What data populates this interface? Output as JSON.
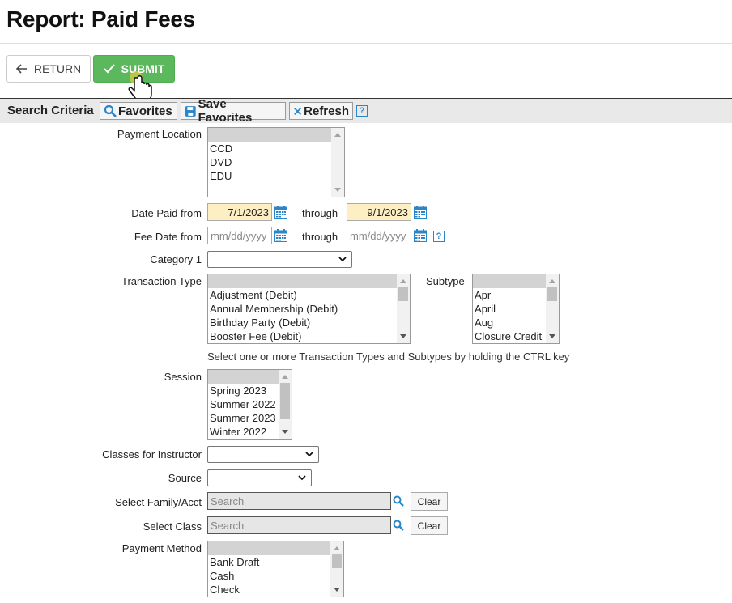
{
  "page": {
    "title": "Report: Paid Fees"
  },
  "actions": {
    "return_label": "RETURN",
    "submit_label": "SUBMIT"
  },
  "criteria": {
    "title": "Search Criteria",
    "favorites_label": "Favorites",
    "save_favorites_label": "Save Favorites",
    "refresh_label": "Refresh",
    "help": "?"
  },
  "fields": {
    "payment_location": {
      "label": "Payment Location",
      "options": [
        "CCD",
        "DVD",
        "EDU"
      ]
    },
    "date_paid": {
      "label": "Date Paid from",
      "from": "7/1/2023",
      "through_label": "through",
      "to": "9/1/2023"
    },
    "fee_date": {
      "label": "Fee Date from",
      "placeholder": "mm/dd/yyyy",
      "through_label": "through"
    },
    "category1": {
      "label": "Category 1",
      "value": ""
    },
    "transaction_type": {
      "label": "Transaction Type",
      "options": [
        "Adjustment (Debit)",
        "Annual Membership (Debit)",
        "Birthday Party (Debit)",
        "Booster Fee (Debit)"
      ]
    },
    "subtype": {
      "label": "Subtype",
      "options": [
        "Apr",
        "April",
        "Aug",
        "Closure Credit"
      ]
    },
    "transaction_note": "Select one or more Transaction Types and Subtypes by holding the CTRL key",
    "session": {
      "label": "Session",
      "options": [
        "Spring 2023",
        "Summer 2022",
        "Summer 2023",
        "Winter 2022"
      ]
    },
    "classes_for_instructor": {
      "label": "Classes for Instructor",
      "value": ""
    },
    "source": {
      "label": "Source",
      "value": ""
    },
    "family": {
      "label": "Select Family/Acct",
      "placeholder": "Search",
      "clear_label": "Clear"
    },
    "class": {
      "label": "Select Class",
      "placeholder": "Search",
      "clear_label": "Clear"
    },
    "payment_method": {
      "label": "Payment Method",
      "options": [
        "Bank Draft",
        "Cash",
        "Check"
      ]
    }
  },
  "colors": {
    "submit": "#5cb85c",
    "filled_date": "#fcefc4",
    "icon_blue": "#2a86c8"
  }
}
